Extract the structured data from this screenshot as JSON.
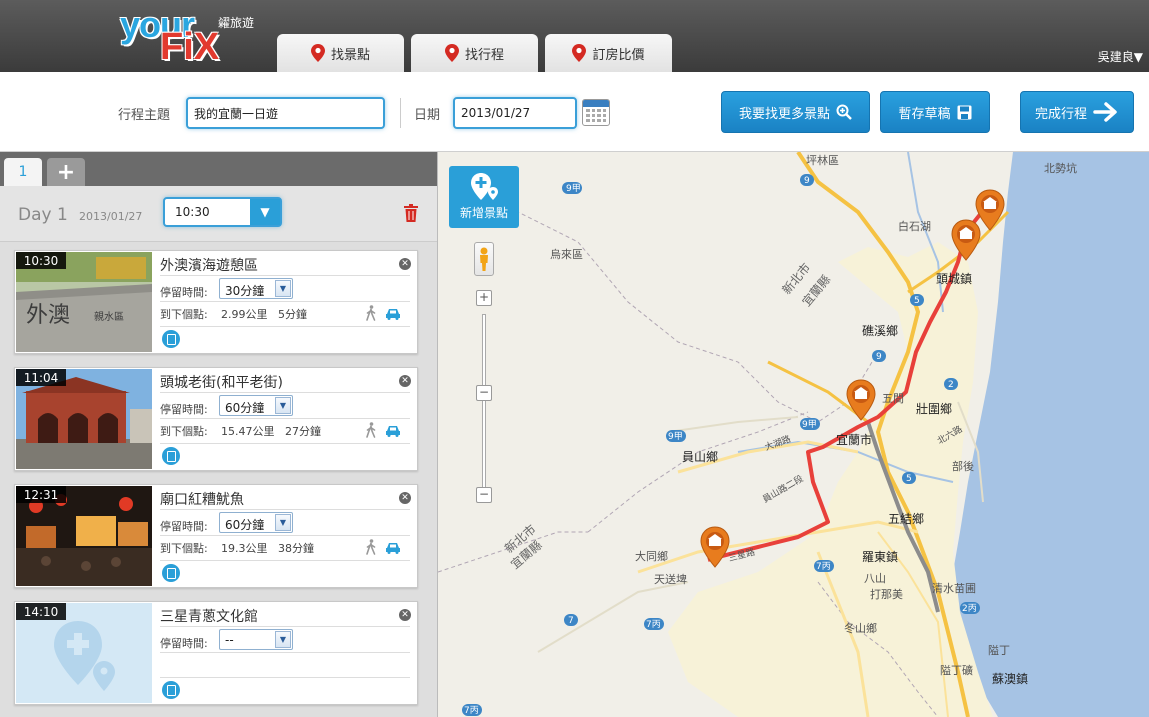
{
  "header": {
    "logo_sub": "糴旅遊",
    "tabs": [
      {
        "label": "找景點"
      },
      {
        "label": "找行程"
      },
      {
        "label": "訂房比價"
      }
    ],
    "user": "吳建良▼"
  },
  "form": {
    "topic_label": "行程主題",
    "topic_value": "我的宜蘭一日遊",
    "date_label": "日期",
    "date_value": "2013/01/27",
    "find_more_label": "我要找更多景點",
    "save_draft_label": "暫存草稿",
    "finish_label": "完成行程"
  },
  "itinerary": {
    "day_tabs": [
      {
        "label": "1"
      },
      {
        "label": "+"
      }
    ],
    "day_title": "Day 1",
    "day_date": "2013/01/27",
    "start_time": "10:30",
    "stops": [
      {
        "time": "10:30",
        "title": "外澳濱海遊憩區",
        "stay_label": "停留時間:",
        "stay": "30分鐘",
        "next_label": "到下個點:",
        "distance": "2.99公里",
        "duration": "5分鐘"
      },
      {
        "time": "11:04",
        "title": "頭城老街(和平老街)",
        "stay_label": "停留時間:",
        "stay": "60分鐘",
        "next_label": "到下個點:",
        "distance": "15.47公里",
        "duration": "27分鐘"
      },
      {
        "time": "12:31",
        "title": "廟口紅糟魷魚",
        "stay_label": "停留時間:",
        "stay": "60分鐘",
        "next_label": "到下個點:",
        "distance": "19.3公里",
        "duration": "38分鐘"
      },
      {
        "time": "14:10",
        "title": "三星青蔥文化館",
        "stay_label": "停留時間:",
        "stay": "--"
      }
    ]
  },
  "map": {
    "add_spot_label": "新增景點",
    "zoom_in": "+",
    "zoom_out": "−",
    "labels": [
      {
        "text": "坪林區"
      },
      {
        "text": "北勢坑"
      },
      {
        "text": "烏來區"
      },
      {
        "text": "白石湖"
      },
      {
        "text": "新北市"
      },
      {
        "text": "宜蘭縣"
      },
      {
        "text": "頭城鎮"
      },
      {
        "text": "礁溪鄉"
      },
      {
        "text": "五間"
      },
      {
        "text": "壯圍鄉"
      },
      {
        "text": "宜蘭市"
      },
      {
        "text": "員山鄉"
      },
      {
        "text": "五結鄉"
      },
      {
        "text": "羅東鎮"
      },
      {
        "text": "大同鄉"
      },
      {
        "text": "天送埤"
      },
      {
        "text": "冬山鄉"
      },
      {
        "text": "清水苗圃"
      },
      {
        "text": "打那美"
      },
      {
        "text": "蘇澳鎮"
      },
      {
        "text": "隘丁"
      },
      {
        "text": "新北市"
      },
      {
        "text": "宜蘭縣"
      },
      {
        "text": "部後"
      },
      {
        "text": "北六路"
      },
      {
        "text": "大湖路"
      },
      {
        "text": "員山路二段"
      },
      {
        "text": "三星路"
      },
      {
        "text": "八山"
      },
      {
        "text": "隘丁礦"
      }
    ],
    "route_color": "#e8403a",
    "marker_color": "#e87c1e",
    "road_highway_color": "#f5c243"
  }
}
